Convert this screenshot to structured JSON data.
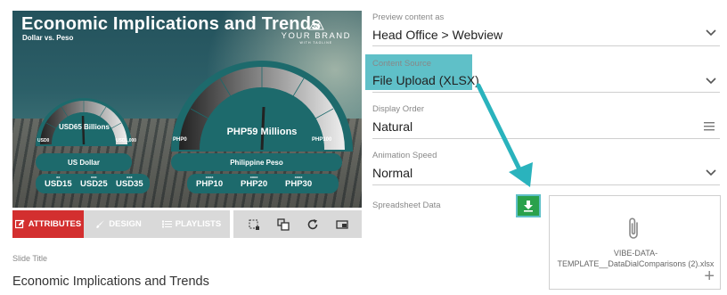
{
  "slide": {
    "title": "Economic Implications and Trends",
    "subtitle": "Dollar vs. Peso",
    "brand_name": "YOUR BRAND",
    "brand_tag": "WITH TAGLINE",
    "gauges": [
      {
        "currency": "US Dollar",
        "center_label": "USD65 Billions",
        "min_label": "USD0",
        "max_label": "USD1,000",
        "values": [
          {
            "year": "xx",
            "value": "USD15"
          },
          {
            "year": "xxx",
            "value": "USD25"
          },
          {
            "year": "xxx",
            "value": "USD35"
          }
        ]
      },
      {
        "currency": "Philippine Peso",
        "center_label": "PHP59 Millions",
        "min_label": "PHP0",
        "max_label": "PHP100",
        "values": [
          {
            "year": "xxxx",
            "value": "PHP10"
          },
          {
            "year": "xxxx",
            "value": "PHP20"
          },
          {
            "year": "xxxx",
            "value": "PHP30"
          }
        ]
      }
    ]
  },
  "tabs": {
    "attributes": "ATTRIBUTES",
    "design": "DESIGN",
    "playlists": "PLAYLISTS"
  },
  "tools": [
    "crop-icon",
    "layers-icon",
    "refresh-icon",
    "screen-icon"
  ],
  "slide_title_field": {
    "label": "Slide Title",
    "value": "Economic Implications and Trends"
  },
  "form": {
    "preview": {
      "label": "Preview content as",
      "value": "Head Office > Webview"
    },
    "source": {
      "label": "Content Source",
      "value": "File Upload (XLSX)"
    },
    "order": {
      "label": "Display Order",
      "value": "Natural"
    },
    "speed": {
      "label": "Animation Speed",
      "value": "Normal"
    },
    "spreadsheet": {
      "label": "Spreadsheet Data",
      "file_name": "VIBE-DATA-TEMPLATE__DataDialComparisons (2).xlsx"
    }
  },
  "colors": {
    "accent_red": "#d32f2f",
    "highlight_teal": "#5fc0c8",
    "download_green": "#2aa14c",
    "slide_teal": "#1d6a6c"
  }
}
